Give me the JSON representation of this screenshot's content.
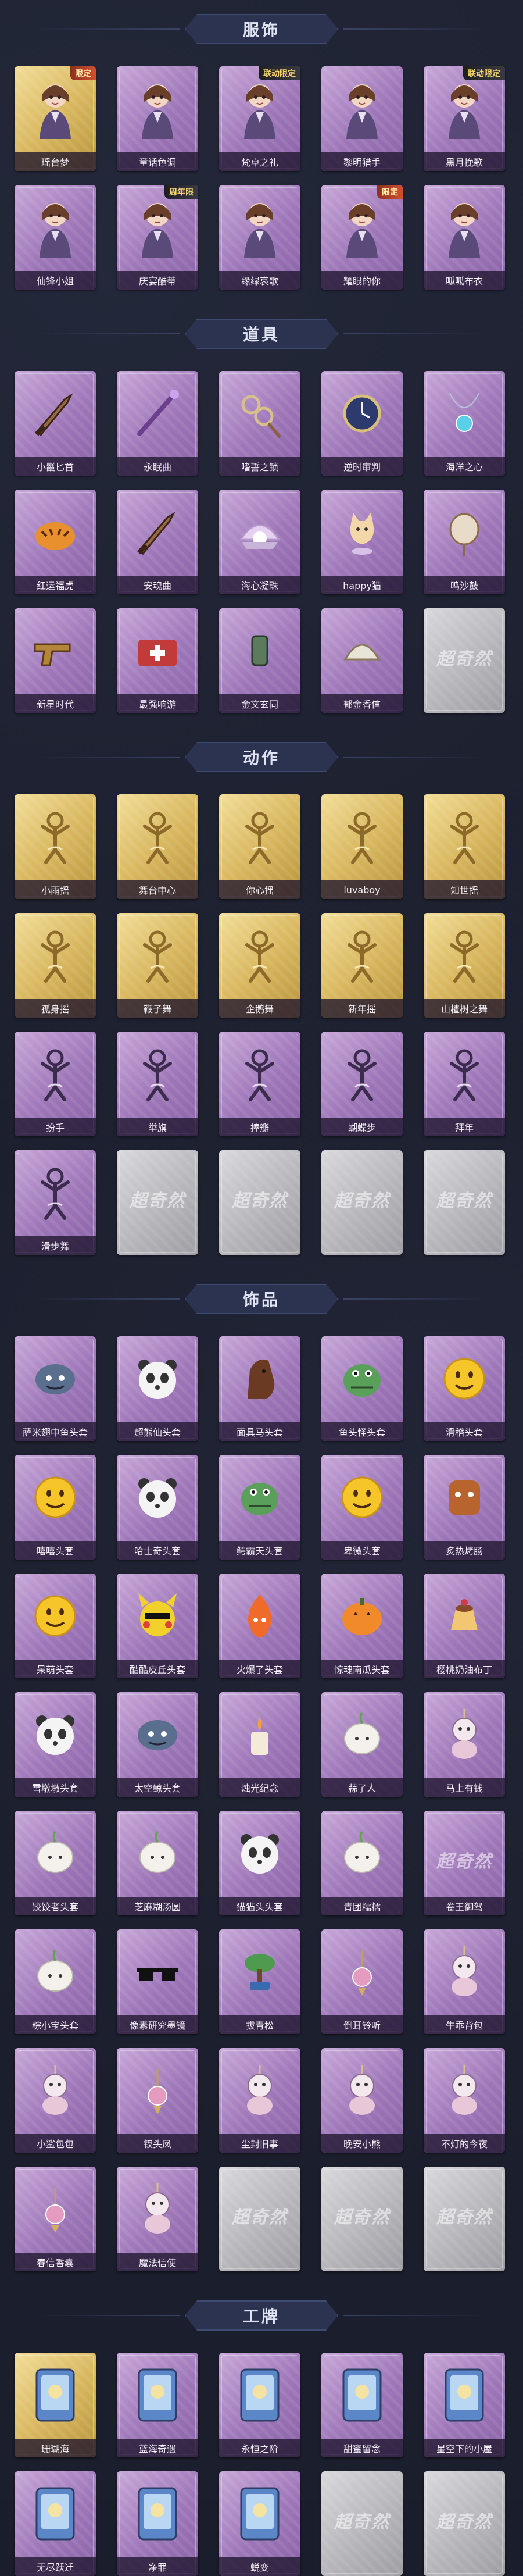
{
  "sections": [
    {
      "title": "服饰",
      "rows": [
        [
          {
            "name": "瑶台梦",
            "rarity": "gold",
            "badge": "限定",
            "icon": "costume-icon"
          },
          {
            "name": "童话色调",
            "rarity": "purple",
            "badge": "",
            "icon": "costume-icon"
          },
          {
            "name": "梵卓之礼",
            "rarity": "purple",
            "badge": "联动限定",
            "icon": "costume-icon"
          },
          {
            "name": "黎明猎手",
            "rarity": "purple",
            "badge": "",
            "icon": "costume-icon"
          },
          {
            "name": "黑月挽歌",
            "rarity": "purple",
            "badge": "联动限定",
            "icon": "costume-icon"
          }
        ],
        [
          {
            "name": "仙锋小姐",
            "rarity": "purple",
            "badge": "",
            "icon": "costume-icon"
          },
          {
            "name": "庆宴酷蒂",
            "rarity": "purple",
            "badge": "周年限",
            "icon": "costume-icon"
          },
          {
            "name": "缘绿哀歌",
            "rarity": "purple",
            "badge": "",
            "icon": "costume-icon"
          },
          {
            "name": "耀眼的你",
            "rarity": "purple",
            "badge": "限定",
            "icon": "costume-icon"
          },
          {
            "name": "呱呱布衣",
            "rarity": "purple",
            "badge": "",
            "icon": "costume-icon"
          }
        ]
      ]
    },
    {
      "title": "道具",
      "rows": [
        [
          {
            "name": "小鬣匕首",
            "rarity": "purple",
            "badge": "",
            "icon": "dagger-icon"
          },
          {
            "name": "永眠曲",
            "rarity": "purple",
            "badge": "",
            "icon": "staff-icon"
          },
          {
            "name": "嗜誓之锁",
            "rarity": "purple",
            "badge": "",
            "icon": "chain-icon"
          },
          {
            "name": "逆时审判",
            "rarity": "purple",
            "badge": "",
            "icon": "pocket-watch-icon"
          },
          {
            "name": "海洋之心",
            "rarity": "purple",
            "badge": "",
            "icon": "pendant-icon"
          }
        ],
        [
          {
            "name": "红运福虎",
            "rarity": "purple",
            "badge": "",
            "icon": "tiger-icon"
          },
          {
            "name": "安魂曲",
            "rarity": "purple",
            "badge": "",
            "icon": "dagger-icon"
          },
          {
            "name": "海心凝珠",
            "rarity": "purple",
            "badge": "",
            "icon": "pearl-shell-icon"
          },
          {
            "name": "happy猫",
            "rarity": "purple",
            "badge": "",
            "icon": "cat-icon"
          },
          {
            "name": "鸣沙鼓",
            "rarity": "purple",
            "badge": "",
            "icon": "drum-icon"
          }
        ],
        [
          {
            "name": "新星时代",
            "rarity": "purple",
            "badge": "",
            "icon": "revolver-icon"
          },
          {
            "name": "最强响游",
            "rarity": "purple",
            "badge": "",
            "icon": "medkit-icon"
          },
          {
            "name": "金文玄同",
            "rarity": "purple",
            "badge": "",
            "icon": "lantern-icon"
          },
          {
            "name": "郁金香信",
            "rarity": "purple",
            "badge": "",
            "icon": "fan-icon"
          },
          {
            "name": "",
            "rarity": "grey",
            "badge": "",
            "icon": "empty-slot"
          }
        ]
      ]
    },
    {
      "title": "动作",
      "rows": [
        [
          {
            "name": "小雨摇",
            "rarity": "gold",
            "badge": "",
            "icon": "pose-icon"
          },
          {
            "name": "舞台中心",
            "rarity": "gold",
            "badge": "",
            "icon": "pose-icon"
          },
          {
            "name": "你心摇",
            "rarity": "gold",
            "badge": "",
            "icon": "pose-icon"
          },
          {
            "name": "luvaboy",
            "rarity": "gold",
            "badge": "",
            "icon": "pose-icon"
          },
          {
            "name": "知世摇",
            "rarity": "gold",
            "badge": "",
            "icon": "pose-icon"
          }
        ],
        [
          {
            "name": "孤身摇",
            "rarity": "gold",
            "badge": "",
            "icon": "pose-icon"
          },
          {
            "name": "鞭子舞",
            "rarity": "gold",
            "badge": "",
            "icon": "pose-icon"
          },
          {
            "name": "企鹅舞",
            "rarity": "gold",
            "badge": "",
            "icon": "pose-icon"
          },
          {
            "name": "新年摇",
            "rarity": "gold",
            "badge": "",
            "icon": "pose-icon"
          },
          {
            "name": "山楂树之舞",
            "rarity": "gold",
            "badge": "",
            "icon": "pose-icon"
          }
        ],
        [
          {
            "name": "扮手",
            "rarity": "purple",
            "badge": "",
            "icon": "pose-icon"
          },
          {
            "name": "举旗",
            "rarity": "purple",
            "badge": "",
            "icon": "pose-icon"
          },
          {
            "name": "捧瓣",
            "rarity": "purple",
            "badge": "",
            "icon": "pose-icon"
          },
          {
            "name": "蝴蝶步",
            "rarity": "purple",
            "badge": "",
            "icon": "pose-icon"
          },
          {
            "name": "拜年",
            "rarity": "purple",
            "badge": "",
            "icon": "pose-icon"
          }
        ],
        [
          {
            "name": "滑步舞",
            "rarity": "purple",
            "badge": "",
            "icon": "pose-icon"
          },
          {
            "name": "",
            "rarity": "grey",
            "badge": "",
            "icon": "empty-slot"
          },
          {
            "name": "",
            "rarity": "grey",
            "badge": "",
            "icon": "empty-slot"
          },
          {
            "name": "",
            "rarity": "grey",
            "badge": "",
            "icon": "empty-slot"
          },
          {
            "name": "",
            "rarity": "grey",
            "badge": "",
            "icon": "empty-slot"
          }
        ]
      ]
    },
    {
      "title": "饰品",
      "rows": [
        [
          {
            "name": "萨米翅中鱼头套",
            "rarity": "purple",
            "badge": "",
            "icon": "fish-head-icon"
          },
          {
            "name": "超熊仙头套",
            "rarity": "purple",
            "badge": "",
            "icon": "panda-head-icon"
          },
          {
            "name": "面具马头套",
            "rarity": "purple",
            "badge": "",
            "icon": "horse-head-icon"
          },
          {
            "name": "鱼头怪头套",
            "rarity": "purple",
            "badge": "",
            "icon": "green-fish-head-icon"
          },
          {
            "name": "滑稽头套",
            "rarity": "purple",
            "badge": "",
            "icon": "smiley-head-icon"
          }
        ],
        [
          {
            "name": "嘻嘻头套",
            "rarity": "purple",
            "badge": "",
            "icon": "grin-head-icon"
          },
          {
            "name": "哈士奇头套",
            "rarity": "purple",
            "badge": "",
            "icon": "husky-head-icon"
          },
          {
            "name": "鳄霸天头套",
            "rarity": "purple",
            "badge": "",
            "icon": "croc-head-icon"
          },
          {
            "name": "卑微头套",
            "rarity": "purple",
            "badge": "",
            "icon": "sad-head-icon"
          },
          {
            "name": "炙热烤肠",
            "rarity": "purple",
            "badge": "",
            "icon": "sausage-head-icon"
          }
        ],
        [
          {
            "name": "呆萌头套",
            "rarity": "purple",
            "badge": "",
            "icon": "dumb-head-icon"
          },
          {
            "name": "酷酷皮丘头套",
            "rarity": "purple",
            "badge": "",
            "icon": "pikachu-head-icon"
          },
          {
            "name": "火爆了头套",
            "rarity": "purple",
            "badge": "",
            "icon": "fire-head-icon"
          },
          {
            "name": "惊魂南瓜头套",
            "rarity": "purple",
            "badge": "",
            "icon": "pumpkin-head-icon"
          },
          {
            "name": "樱桃奶油布丁",
            "rarity": "purple",
            "badge": "",
            "icon": "pudding-icon"
          }
        ],
        [
          {
            "name": "雪墩墩头套",
            "rarity": "purple",
            "badge": "",
            "icon": "snowman-head-icon"
          },
          {
            "name": "太空鲸头套",
            "rarity": "purple",
            "badge": "",
            "icon": "whale-head-icon"
          },
          {
            "name": "烛光纪念",
            "rarity": "purple",
            "badge": "",
            "icon": "candle-icon"
          },
          {
            "name": "蒜了人",
            "rarity": "purple",
            "badge": "",
            "icon": "garlic-icon"
          },
          {
            "name": "马上有钱",
            "rarity": "purple",
            "badge": "",
            "icon": "horse-plush-icon"
          }
        ],
        [
          {
            "name": "饺饺者头套",
            "rarity": "purple",
            "badge": "",
            "icon": "dumpling-head-icon"
          },
          {
            "name": "芝麻糊汤圆",
            "rarity": "purple",
            "badge": "",
            "icon": "tangyuan-icon"
          },
          {
            "name": "猫猫头头套",
            "rarity": "purple",
            "badge": "",
            "icon": "cat-head-icon"
          },
          {
            "name": "青团糯糯",
            "rarity": "purple",
            "badge": "",
            "icon": "qingtuan-icon"
          },
          {
            "name": "卷王御驾",
            "rarity": "purple",
            "badge": "",
            "icon": "empty-slot"
          }
        ],
        [
          {
            "name": "粽小宝头套",
            "rarity": "purple",
            "badge": "",
            "icon": "zongzi-head-icon"
          },
          {
            "name": "像素研究墨镜",
            "rarity": "purple",
            "badge": "",
            "icon": "pixel-glasses-icon"
          },
          {
            "name": "拔青松",
            "rarity": "purple",
            "badge": "",
            "icon": "bonsai-icon"
          },
          {
            "name": "倒耳铃听",
            "rarity": "purple",
            "badge": "",
            "icon": "earring-icon"
          },
          {
            "name": "牛乖背包",
            "rarity": "purple",
            "badge": "",
            "icon": "cow-backpack-icon"
          }
        ],
        [
          {
            "name": "小鲨包包",
            "rarity": "purple",
            "badge": "",
            "icon": "shark-bag-icon"
          },
          {
            "name": "钗头凤",
            "rarity": "purple",
            "badge": "",
            "icon": "hairpin-icon"
          },
          {
            "name": "尘封旧事",
            "rarity": "purple",
            "badge": "",
            "icon": "doll-icon"
          },
          {
            "name": "晚安小熊",
            "rarity": "purple",
            "badge": "",
            "icon": "bear-charm-icon"
          },
          {
            "name": "不灯的今夜",
            "rarity": "purple",
            "badge": "",
            "icon": "bunny-charm-icon"
          }
        ],
        [
          {
            "name": "春信香囊",
            "rarity": "purple",
            "badge": "",
            "icon": "sachet-icon"
          },
          {
            "name": "魔法信使",
            "rarity": "purple",
            "badge": "",
            "icon": "elephant-plush-icon"
          },
          {
            "name": "",
            "rarity": "grey",
            "badge": "",
            "icon": "empty-slot"
          },
          {
            "name": "",
            "rarity": "grey",
            "badge": "",
            "icon": "empty-slot"
          },
          {
            "name": "",
            "rarity": "grey",
            "badge": "",
            "icon": "empty-slot"
          }
        ]
      ]
    },
    {
      "title": "工牌",
      "rows": [
        [
          {
            "name": "珊瑚海",
            "rarity": "gold",
            "badge": "",
            "icon": "card-frame-icon"
          },
          {
            "name": "蓝海奇遇",
            "rarity": "purple",
            "badge": "",
            "icon": "card-frame-icon"
          },
          {
            "name": "永恒之阶",
            "rarity": "purple",
            "badge": "",
            "icon": "card-frame-icon"
          },
          {
            "name": "甜蜜留念",
            "rarity": "purple",
            "badge": "",
            "icon": "card-frame-icon"
          },
          {
            "name": "星空下的小屋",
            "rarity": "purple",
            "badge": "",
            "icon": "card-frame-icon"
          }
        ],
        [
          {
            "name": "无尽跃迁",
            "rarity": "purple",
            "badge": "",
            "icon": "card-frame-icon"
          },
          {
            "name": "净罪",
            "rarity": "purple",
            "badge": "",
            "icon": "card-frame-icon"
          },
          {
            "name": "蜕变",
            "rarity": "purple",
            "badge": "",
            "icon": "card-frame-icon"
          },
          {
            "name": "",
            "rarity": "grey",
            "badge": "",
            "icon": "empty-slot"
          },
          {
            "name": "",
            "rarity": "grey",
            "badge": "",
            "icon": "empty-slot"
          }
        ]
      ]
    }
  ],
  "watermark_text": "超奇然",
  "colors": {
    "background": "#1b1e2c",
    "header_plate": "#2c3350",
    "purple_card": "#9d76b8",
    "gold_card": "#d9b860",
    "grey_card": "#b3b3b8"
  }
}
